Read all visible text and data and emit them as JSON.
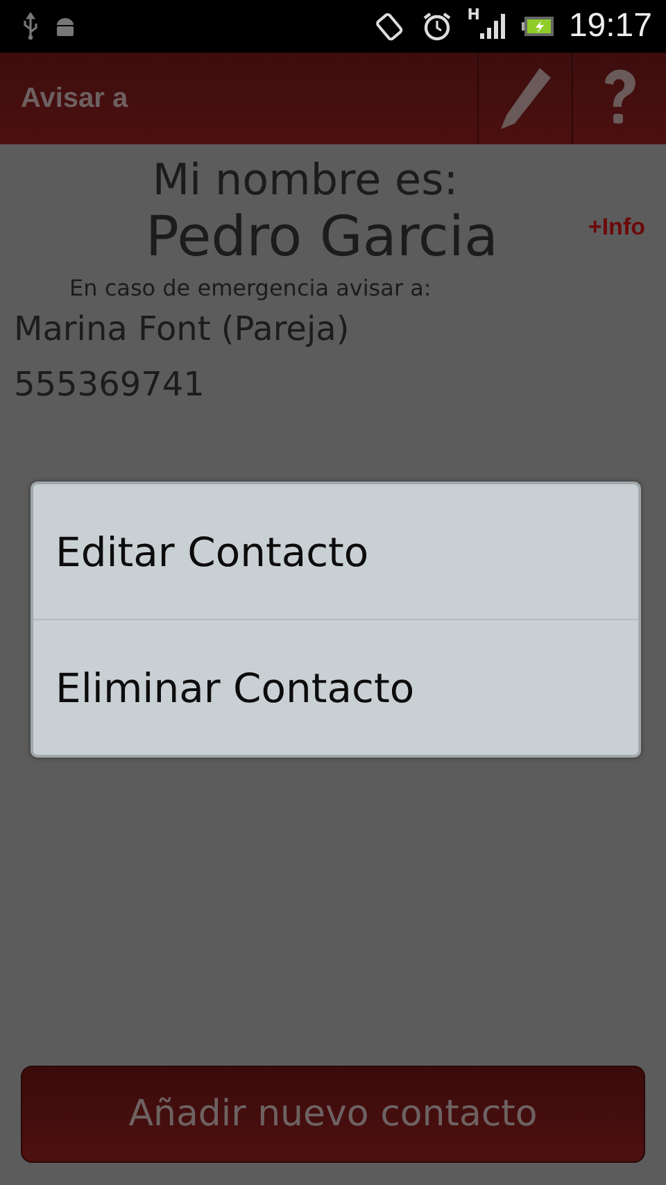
{
  "status_bar": {
    "network_type": "H",
    "time": "19:17"
  },
  "header": {
    "title": "Avisar a"
  },
  "profile": {
    "intro": "Mi nombre es:",
    "name": "Pedro Garcia",
    "info_link": "+Info",
    "contacts_heading": "En caso de emergencia avisar a:"
  },
  "contacts": [
    {
      "name": "Marina Font  (Pareja)",
      "phone": "555369741"
    }
  ],
  "context_menu": {
    "items": [
      {
        "label": "Editar Contacto"
      },
      {
        "label": "Eliminar Contacto"
      }
    ]
  },
  "add_button": {
    "label": "Añadir nuevo contacto"
  }
}
